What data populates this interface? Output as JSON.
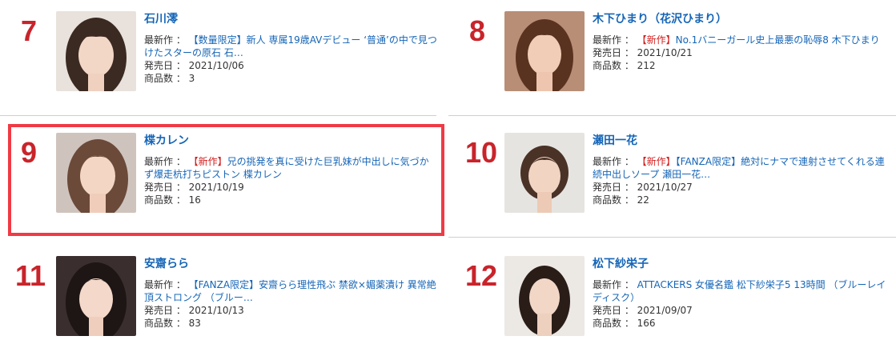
{
  "labels": {
    "latest": "最新作 ：",
    "release": "発売日 ：",
    "count": "商品数 ："
  },
  "highlight_color": "#f03a45",
  "accent_color": "#c9242b",
  "link_color": "#1565b7",
  "actresses": [
    {
      "rank": "7",
      "name": "石川澪",
      "is_new": false,
      "new_tag": "",
      "latest_title": "【数量限定】新人 専属19歳AVデビュー ‘普通’の中で見つけたスターの原石 石…",
      "release_date": "2021/10/06",
      "product_count": "3"
    },
    {
      "rank": "8",
      "name": "木下ひまり（花沢ひまり）",
      "is_new": true,
      "new_tag": "【新作】",
      "latest_title": "No.1バニーガール史上最悪の恥辱8 木下ひまり",
      "release_date": "2021/10/21",
      "product_count": "212"
    },
    {
      "rank": "9",
      "name": "楪カレン",
      "is_new": true,
      "new_tag": "【新作】",
      "latest_title": "兄の挑発を真に受けた巨乳妹が中出しに気づかず爆走杭打ちピストン 楪カレン",
      "release_date": "2021/10/19",
      "product_count": "16"
    },
    {
      "rank": "10",
      "name": "瀬田一花",
      "is_new": true,
      "new_tag": "【新作】",
      "latest_title": "【FANZA限定】絶対にナマで連射させてくれる連続中出しソープ 瀬田一花…",
      "release_date": "2021/10/27",
      "product_count": "22"
    },
    {
      "rank": "11",
      "name": "安齋らら",
      "is_new": false,
      "new_tag": "",
      "latest_title": "【FANZA限定】安齋らら理性飛ぶ 禁欲×媚薬漬け 異常絶頂ストロング （ブルー…",
      "release_date": "2021/10/13",
      "product_count": "83"
    },
    {
      "rank": "12",
      "name": "松下紗栄子",
      "is_new": false,
      "new_tag": "",
      "latest_title": "ATTACKERS 女優名鑑 松下紗栄子5 13時間 （ブルーレイディスク）",
      "release_date": "2021/09/07",
      "product_count": "166"
    }
  ]
}
